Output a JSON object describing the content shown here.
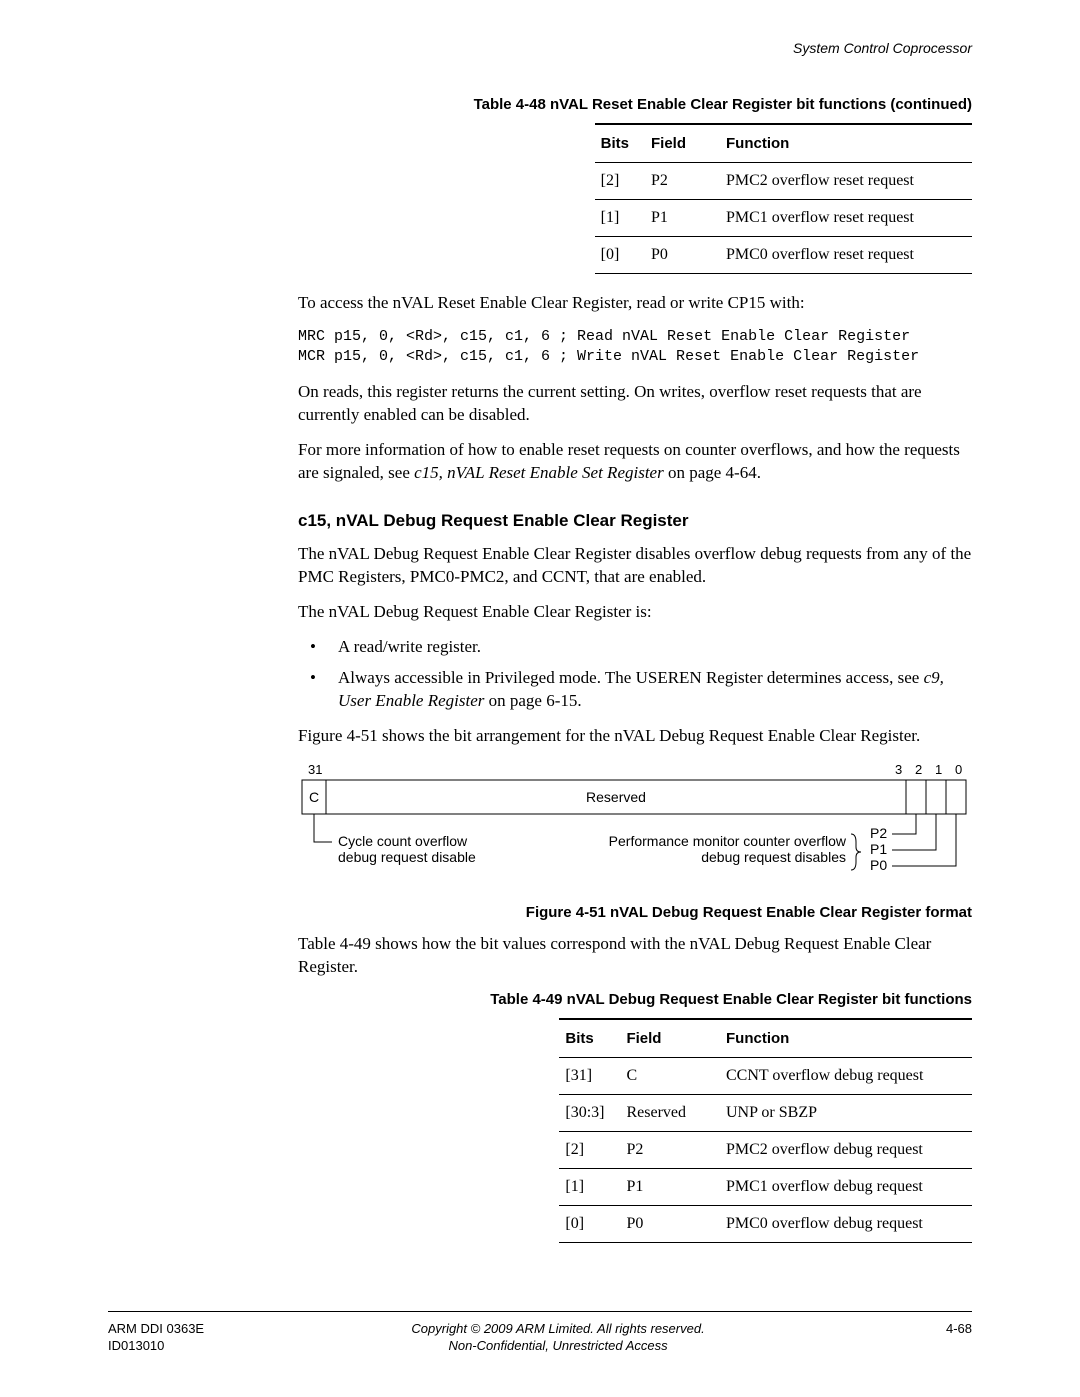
{
  "running_head": "System Control Coprocessor",
  "table448": {
    "caption": "Table 4-48 nVAL Reset Enable Clear Register bit functions (continued)",
    "headers": {
      "bits": "Bits",
      "field": "Field",
      "function": "Function"
    },
    "rows": [
      {
        "bits": "[2]",
        "field": "P2",
        "func": "PMC2 overflow reset request"
      },
      {
        "bits": "[1]",
        "field": "P1",
        "func": "PMC1 overflow reset request"
      },
      {
        "bits": "[0]",
        "field": "P0",
        "func": "PMC0 overflow reset request"
      }
    ]
  },
  "para_access": "To access the nVAL Reset Enable Clear Register, read or write CP15 with:",
  "code_block": "MRC p15, 0, <Rd>, c15, c1, 6 ; Read nVAL Reset Enable Clear Register\nMCR p15, 0, <Rd>, c15, c1, 6 ; Write nVAL Reset Enable Clear Register",
  "para_onreads": "On reads, this register returns the current setting. On writes, overflow reset requests that are currently enabled can be disabled.",
  "para_moreinfo_a": "For more information of how to enable reset requests on counter overflows, and how the requests are signaled, see ",
  "para_moreinfo_ref": "c15, nVAL Reset Enable Set Register",
  "para_moreinfo_b": " on page 4-64.",
  "heading_c15": "c15, nVAL Debug Request Enable Clear Register",
  "para_clear1": "The nVAL Debug Request Enable Clear Register disables overflow debug requests from any of the PMC Registers, PMC0-PMC2, and CCNT, that are enabled.",
  "para_clear2": "The nVAL Debug Request Enable Clear Register is:",
  "bullet1": "A read/write register.",
  "bullet2_a": "Always accessible in Privileged mode. The USEREN Register determines access, see ",
  "bullet2_ref": "c9, User Enable Register",
  "bullet2_b": " on page 6-15.",
  "para_fig": "Figure 4-51 shows the bit arrangement for the nVAL Debug Request Enable Clear Register.",
  "figure": {
    "caption": "Figure 4-51 nVAL Debug Request Enable Clear Register format",
    "bit31": "31",
    "bit3": "3",
    "bit2": "2",
    "bit1": "1",
    "bit0": "0",
    "C": "C",
    "Reserved": "Reserved",
    "left_line1": "Cycle count overflow",
    "left_line2": "debug request disable",
    "mid_line1": "Performance monitor counter overflow",
    "mid_line2": "debug request disables",
    "P2": "P2",
    "P1": "P1",
    "P0": "P0"
  },
  "para_table449": "Table 4-49 shows how the bit values correspond with the nVAL Debug Request Enable Clear Register.",
  "table449": {
    "caption": "Table 4-49 nVAL Debug Request Enable Clear Register bit functions",
    "headers": {
      "bits": "Bits",
      "field": "Field",
      "function": "Function"
    },
    "rows": [
      {
        "bits": "[31]",
        "field": "C",
        "func": "CCNT overflow debug request"
      },
      {
        "bits": "[30:3]",
        "field": "Reserved",
        "func": "UNP or SBZP"
      },
      {
        "bits": "[2]",
        "field": "P2",
        "func": "PMC2 overflow debug request"
      },
      {
        "bits": "[1]",
        "field": "P1",
        "func": "PMC1 overflow debug request"
      },
      {
        "bits": "[0]",
        "field": "P0",
        "func": "PMC0 overflow debug request"
      }
    ]
  },
  "footer": {
    "left1": "ARM DDI 0363E",
    "left2": "ID013010",
    "center1": "Copyright © 2009 ARM Limited. All rights reserved.",
    "center2": "Non-Confidential, Unrestricted Access",
    "right": "4-68"
  }
}
